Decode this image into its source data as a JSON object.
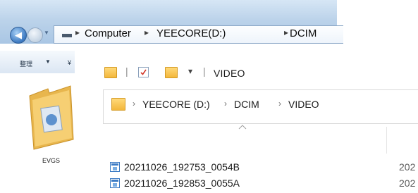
{
  "back_window": {
    "address": {
      "segments": [
        "Computer",
        "YEECORE(D:)",
        "DCIM"
      ]
    },
    "toolbar": {
      "organize_label": "整理",
      "second_label": "¥"
    },
    "folder_item": {
      "label": "EVGS"
    }
  },
  "front_window": {
    "quick_access": {
      "title": "VIDEO"
    },
    "address": {
      "segments": [
        "YEECORE (D:)",
        "DCIM",
        "VIDEO"
      ]
    },
    "files": [
      {
        "name": "20211026_192753_0054B",
        "date": "202"
      },
      {
        "name": "20211026_192853_0055A",
        "date": "202"
      }
    ]
  },
  "icons": {
    "back": "back-arrow-icon",
    "forward": "forward-arrow-icon",
    "folder": "folder-icon",
    "properties": "properties-check-icon",
    "video_file": "video-file-icon",
    "sort": "sort-up-icon"
  },
  "colors": {
    "titlebar": "#bcd3ea",
    "folder": "#f3b73b",
    "file_icon": "#3c7bc4"
  }
}
